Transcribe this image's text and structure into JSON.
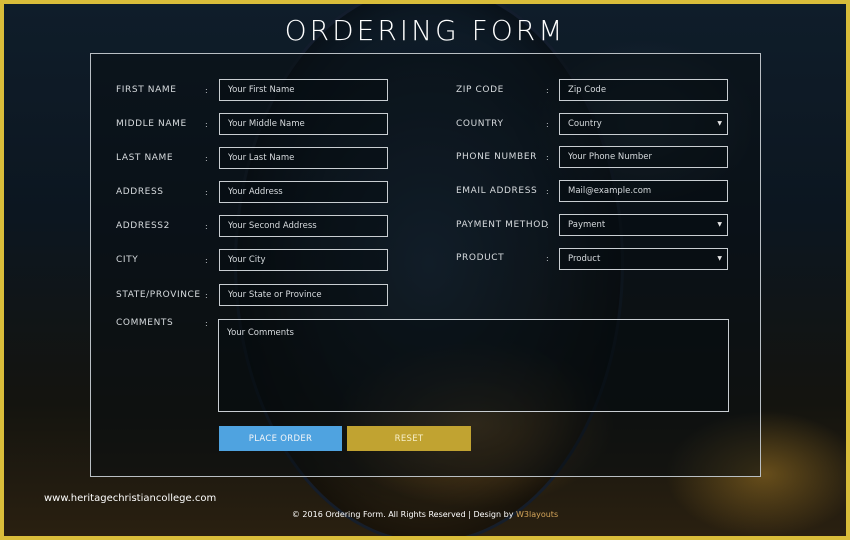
{
  "colors": {
    "border": "#d9bd3a",
    "place_order_button": "#4fa3e0",
    "reset_button": "#c1a331",
    "footer_brand": "#d4a55a"
  },
  "page": {
    "title": "ORDERING FORM"
  },
  "form": {
    "left": [
      {
        "label": "FIRST NAME",
        "placeholder": "Your First Name"
      },
      {
        "label": "MIDDLE NAME",
        "placeholder": "Your Middle Name"
      },
      {
        "label": "LAST NAME",
        "placeholder": "Your Last Name"
      },
      {
        "label": "ADDRESS",
        "placeholder": "Your Address"
      },
      {
        "label": "ADDRESS2",
        "placeholder": "Your Second Address"
      },
      {
        "label": "CITY",
        "placeholder": "Your City"
      },
      {
        "label": "STATE/PROVINCE",
        "placeholder": "Your State or Province"
      }
    ],
    "right": [
      {
        "label": "ZIP CODE",
        "placeholder": "Zip Code",
        "type": "text"
      },
      {
        "label": "COUNTRY",
        "value": "Country",
        "type": "select"
      },
      {
        "label": "PHONE NUMBER",
        "placeholder": "Your Phone Number",
        "type": "text"
      },
      {
        "label": "EMAIL ADDRESS",
        "placeholder": "Mail@example.com",
        "type": "text"
      },
      {
        "label": "PAYMENT METHOD",
        "value": "Payment",
        "type": "select"
      },
      {
        "label": "PRODUCT",
        "value": "Product",
        "type": "select"
      }
    ],
    "comments": {
      "label": "COMMENTS",
      "placeholder": "Your Comments"
    },
    "colon": ":",
    "caret": "▼",
    "buttons": {
      "place_order": "PLACE ORDER",
      "reset": "RESET"
    }
  },
  "watermark": "www.heritagechristiancollege.com",
  "footer": {
    "text": "© 2016 Ordering Form. All Rights Reserved | Design by ",
    "brand": "W3layouts"
  }
}
